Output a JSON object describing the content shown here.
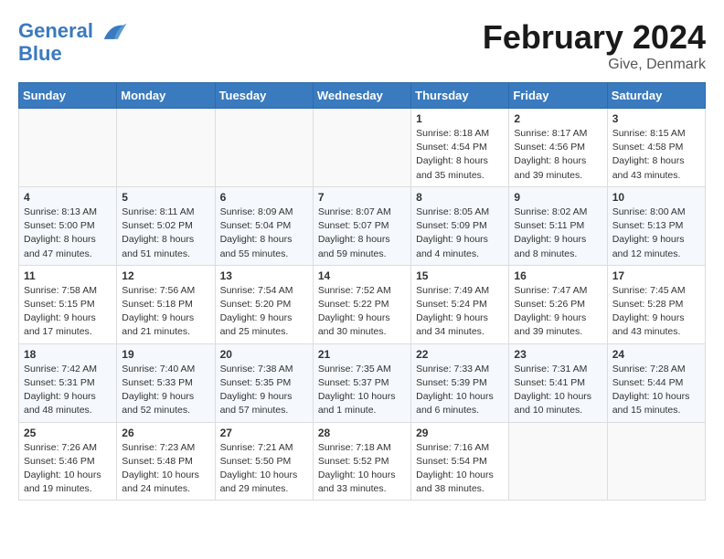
{
  "header": {
    "logo_line1": "General",
    "logo_line2": "Blue",
    "main_title": "February 2024",
    "subtitle": "Give, Denmark"
  },
  "weekdays": [
    "Sunday",
    "Monday",
    "Tuesday",
    "Wednesday",
    "Thursday",
    "Friday",
    "Saturday"
  ],
  "weeks": [
    [
      {
        "day": "",
        "info": ""
      },
      {
        "day": "",
        "info": ""
      },
      {
        "day": "",
        "info": ""
      },
      {
        "day": "",
        "info": ""
      },
      {
        "day": "1",
        "info": "Sunrise: 8:18 AM\nSunset: 4:54 PM\nDaylight: 8 hours\nand 35 minutes."
      },
      {
        "day": "2",
        "info": "Sunrise: 8:17 AM\nSunset: 4:56 PM\nDaylight: 8 hours\nand 39 minutes."
      },
      {
        "day": "3",
        "info": "Sunrise: 8:15 AM\nSunset: 4:58 PM\nDaylight: 8 hours\nand 43 minutes."
      }
    ],
    [
      {
        "day": "4",
        "info": "Sunrise: 8:13 AM\nSunset: 5:00 PM\nDaylight: 8 hours\nand 47 minutes."
      },
      {
        "day": "5",
        "info": "Sunrise: 8:11 AM\nSunset: 5:02 PM\nDaylight: 8 hours\nand 51 minutes."
      },
      {
        "day": "6",
        "info": "Sunrise: 8:09 AM\nSunset: 5:04 PM\nDaylight: 8 hours\nand 55 minutes."
      },
      {
        "day": "7",
        "info": "Sunrise: 8:07 AM\nSunset: 5:07 PM\nDaylight: 8 hours\nand 59 minutes."
      },
      {
        "day": "8",
        "info": "Sunrise: 8:05 AM\nSunset: 5:09 PM\nDaylight: 9 hours\nand 4 minutes."
      },
      {
        "day": "9",
        "info": "Sunrise: 8:02 AM\nSunset: 5:11 PM\nDaylight: 9 hours\nand 8 minutes."
      },
      {
        "day": "10",
        "info": "Sunrise: 8:00 AM\nSunset: 5:13 PM\nDaylight: 9 hours\nand 12 minutes."
      }
    ],
    [
      {
        "day": "11",
        "info": "Sunrise: 7:58 AM\nSunset: 5:15 PM\nDaylight: 9 hours\nand 17 minutes."
      },
      {
        "day": "12",
        "info": "Sunrise: 7:56 AM\nSunset: 5:18 PM\nDaylight: 9 hours\nand 21 minutes."
      },
      {
        "day": "13",
        "info": "Sunrise: 7:54 AM\nSunset: 5:20 PM\nDaylight: 9 hours\nand 25 minutes."
      },
      {
        "day": "14",
        "info": "Sunrise: 7:52 AM\nSunset: 5:22 PM\nDaylight: 9 hours\nand 30 minutes."
      },
      {
        "day": "15",
        "info": "Sunrise: 7:49 AM\nSunset: 5:24 PM\nDaylight: 9 hours\nand 34 minutes."
      },
      {
        "day": "16",
        "info": "Sunrise: 7:47 AM\nSunset: 5:26 PM\nDaylight: 9 hours\nand 39 minutes."
      },
      {
        "day": "17",
        "info": "Sunrise: 7:45 AM\nSunset: 5:28 PM\nDaylight: 9 hours\nand 43 minutes."
      }
    ],
    [
      {
        "day": "18",
        "info": "Sunrise: 7:42 AM\nSunset: 5:31 PM\nDaylight: 9 hours\nand 48 minutes."
      },
      {
        "day": "19",
        "info": "Sunrise: 7:40 AM\nSunset: 5:33 PM\nDaylight: 9 hours\nand 52 minutes."
      },
      {
        "day": "20",
        "info": "Sunrise: 7:38 AM\nSunset: 5:35 PM\nDaylight: 9 hours\nand 57 minutes."
      },
      {
        "day": "21",
        "info": "Sunrise: 7:35 AM\nSunset: 5:37 PM\nDaylight: 10 hours\nand 1 minute."
      },
      {
        "day": "22",
        "info": "Sunrise: 7:33 AM\nSunset: 5:39 PM\nDaylight: 10 hours\nand 6 minutes."
      },
      {
        "day": "23",
        "info": "Sunrise: 7:31 AM\nSunset: 5:41 PM\nDaylight: 10 hours\nand 10 minutes."
      },
      {
        "day": "24",
        "info": "Sunrise: 7:28 AM\nSunset: 5:44 PM\nDaylight: 10 hours\nand 15 minutes."
      }
    ],
    [
      {
        "day": "25",
        "info": "Sunrise: 7:26 AM\nSunset: 5:46 PM\nDaylight: 10 hours\nand 19 minutes."
      },
      {
        "day": "26",
        "info": "Sunrise: 7:23 AM\nSunset: 5:48 PM\nDaylight: 10 hours\nand 24 minutes."
      },
      {
        "day": "27",
        "info": "Sunrise: 7:21 AM\nSunset: 5:50 PM\nDaylight: 10 hours\nand 29 minutes."
      },
      {
        "day": "28",
        "info": "Sunrise: 7:18 AM\nSunset: 5:52 PM\nDaylight: 10 hours\nand 33 minutes."
      },
      {
        "day": "29",
        "info": "Sunrise: 7:16 AM\nSunset: 5:54 PM\nDaylight: 10 hours\nand 38 minutes."
      },
      {
        "day": "",
        "info": ""
      },
      {
        "day": "",
        "info": ""
      }
    ]
  ]
}
